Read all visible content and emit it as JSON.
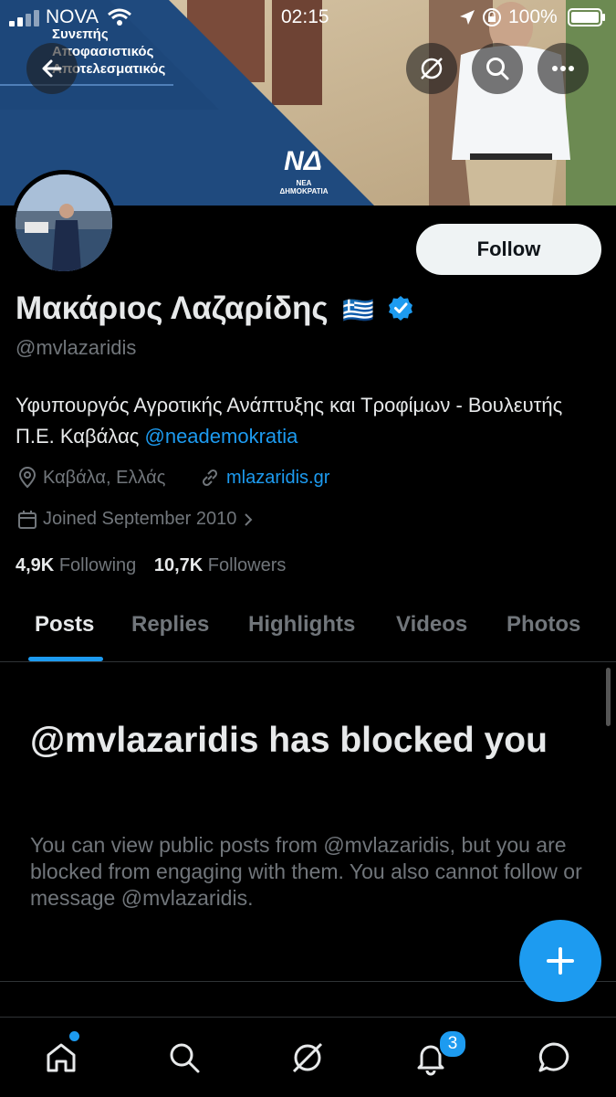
{
  "status_bar": {
    "carrier": "NOVA",
    "time": "02:15",
    "battery": "100%"
  },
  "banner": {
    "slogan_lines": [
      "Συνεπής",
      "Αποφασιστικός",
      "Αποτελεσματικός"
    ],
    "party_logo": "ΝΔ",
    "party_name": "ΝΕΑ ΔΗΜΟΚΡΑΤΙΑ"
  },
  "header": {
    "back_icon": "back-arrow-icon",
    "grok_icon": "grok-icon",
    "search_icon": "search-icon",
    "more_icon": "more-icon"
  },
  "profile": {
    "display_name": "Μακάριος Λαζαρίδης",
    "flag": "🇬🇷",
    "handle": "@mvlazaridis",
    "bio_text": "Υφυπουργός Αγροτικής Ανάπτυξης και Τροφίμων - Βουλευτής Π.Ε. Καβάλας ",
    "bio_mention": "@neademokratia",
    "location": "Καβάλα, Ελλάς",
    "website": "mlazaridis.gr",
    "joined": "Joined September 2010",
    "following_count": "4,9K",
    "following_label": "Following",
    "followers_count": "10,7K",
    "followers_label": "Followers"
  },
  "follow_button": {
    "label": "Follow"
  },
  "tabs": [
    {
      "label": "Posts",
      "active": true
    },
    {
      "label": "Replies",
      "active": false
    },
    {
      "label": "Highlights",
      "active": false
    },
    {
      "label": "Videos",
      "active": false
    },
    {
      "label": "Photos",
      "active": false
    }
  ],
  "blocked_notice": {
    "title": "@mvlazaridis has blocked you",
    "body": "You can view public posts from @mvlazaridis, but you are blocked from engaging with them. You also cannot follow or message @mvlazaridis."
  },
  "bottom_nav": {
    "notifications_badge": "3"
  },
  "colors": {
    "accent": "#1d9bf0",
    "background": "#000000",
    "muted": "#71767b"
  }
}
